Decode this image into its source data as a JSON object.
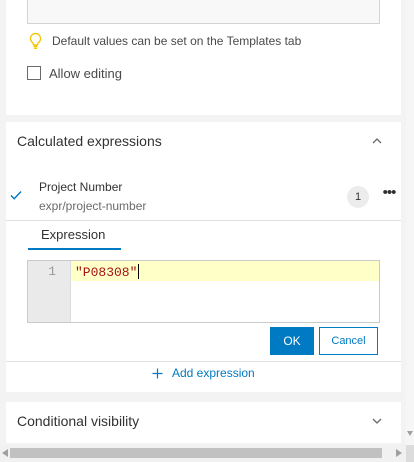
{
  "field_settings": {
    "hint_text": "Default values can be set on the Templates tab",
    "allow_editing_label": "Allow editing",
    "allow_editing_checked": false
  },
  "calculated_expressions": {
    "section_title": "Calculated expressions",
    "expanded": true,
    "item": {
      "name": "Project Number",
      "id": "expr/project-number",
      "count": "1",
      "selected": true
    },
    "active_tab": "Expression",
    "editor": {
      "line_number": "1",
      "code": "\"P08308\""
    },
    "ok_label": "OK",
    "cancel_label": "Cancel",
    "add_expression_label": "Add expression"
  },
  "conditional_visibility": {
    "section_title": "Conditional visibility",
    "expanded": false
  },
  "colors": {
    "accent": "#007ac2",
    "hint_icon": "#f5c400",
    "code_string": "#a31515",
    "active_line": "#ffffc8"
  }
}
